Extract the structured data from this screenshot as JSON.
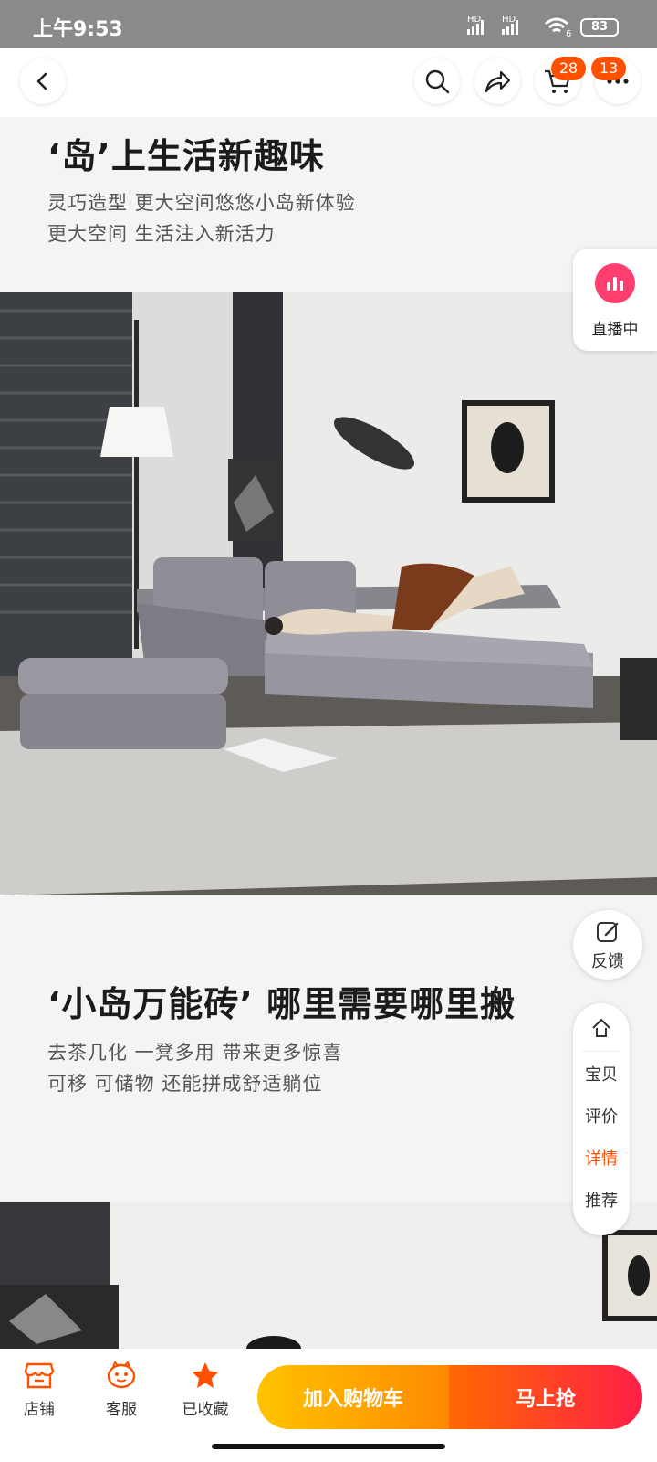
{
  "status_bar": {
    "time": "上午9:53",
    "network_1": "HD",
    "network_2": "HD",
    "wifi_sub": "6",
    "battery": "83"
  },
  "top_nav": {
    "back_icon": "chevron-left-icon",
    "search_icon": "search-icon",
    "share_icon": "share-icon",
    "cart_icon": "cart-icon",
    "cart_badge": "28",
    "more_badge": "13"
  },
  "section1": {
    "headline": "‘岛’上生活新趣味",
    "sub_line_1": "灵巧造型 更大空间悠悠小岛新体验",
    "sub_line_2": "更大空间 生活注入新活力"
  },
  "section2": {
    "headline": "‘小岛万能砖’ 哪里需要哪里搬",
    "sub_line_1": "去茶几化 一凳多用 带来更多惊喜",
    "sub_line_2": "可移 可储物 还能拼成舒适躺位"
  },
  "live_widget": {
    "label": "直播中",
    "icon": "live-bars-icon",
    "accent": "#ff3d6e"
  },
  "feedback": {
    "label": "反馈",
    "icon": "edit-icon"
  },
  "side_nav": {
    "top_icon": "back-to-top-icon",
    "items": [
      {
        "label": "宝贝",
        "active": false
      },
      {
        "label": "评价",
        "active": false
      },
      {
        "label": "详情",
        "active": true
      },
      {
        "label": "推荐",
        "active": false
      }
    ]
  },
  "bottom_bar": {
    "store_label": "店铺",
    "service_label": "客服",
    "favorite_label": "已收藏",
    "add_to_cart": "加入购物车",
    "buy_now": "马上抢",
    "accent": "#ff5000"
  }
}
